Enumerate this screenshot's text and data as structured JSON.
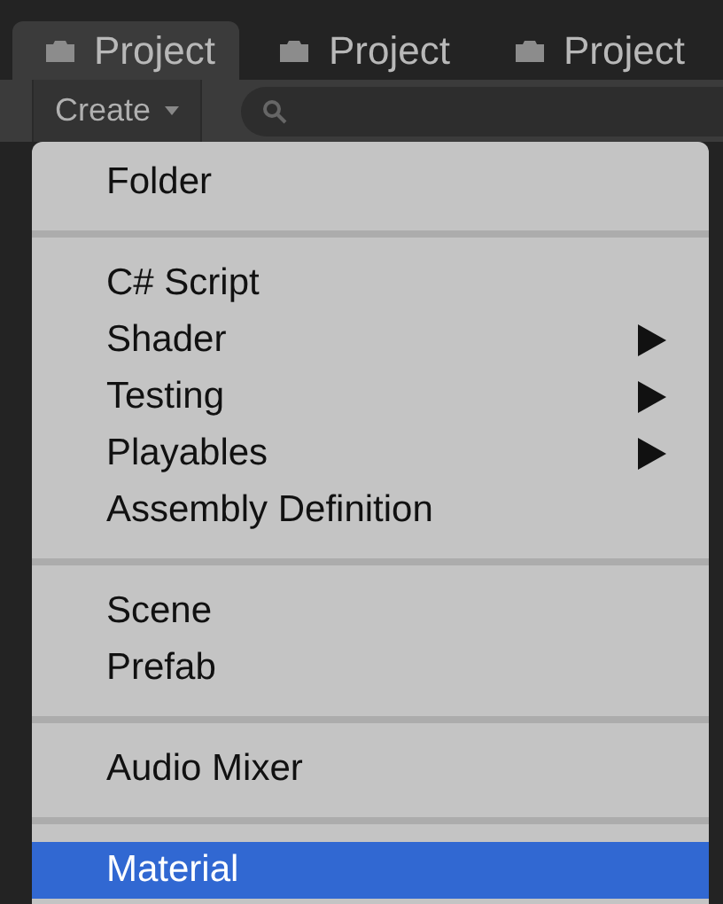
{
  "tabs": [
    {
      "label": "Project",
      "selected": true
    },
    {
      "label": "Project",
      "selected": false
    },
    {
      "label": "Project",
      "selected": false
    }
  ],
  "toolbar": {
    "create_button": "Create"
  },
  "menu": {
    "groups": [
      {
        "items": [
          {
            "label": "Folder",
            "submenu": false,
            "selected": false
          }
        ]
      },
      {
        "items": [
          {
            "label": "C# Script",
            "submenu": false,
            "selected": false
          },
          {
            "label": "Shader",
            "submenu": true,
            "selected": false
          },
          {
            "label": "Testing",
            "submenu": true,
            "selected": false
          },
          {
            "label": "Playables",
            "submenu": true,
            "selected": false
          },
          {
            "label": "Assembly Definition",
            "submenu": false,
            "selected": false
          }
        ]
      },
      {
        "items": [
          {
            "label": "Scene",
            "submenu": false,
            "selected": false
          },
          {
            "label": "Prefab",
            "submenu": false,
            "selected": false
          }
        ]
      },
      {
        "items": [
          {
            "label": "Audio Mixer",
            "submenu": false,
            "selected": false
          }
        ]
      },
      {
        "items": [
          {
            "label": "Material",
            "submenu": false,
            "selected": true
          }
        ]
      }
    ]
  }
}
